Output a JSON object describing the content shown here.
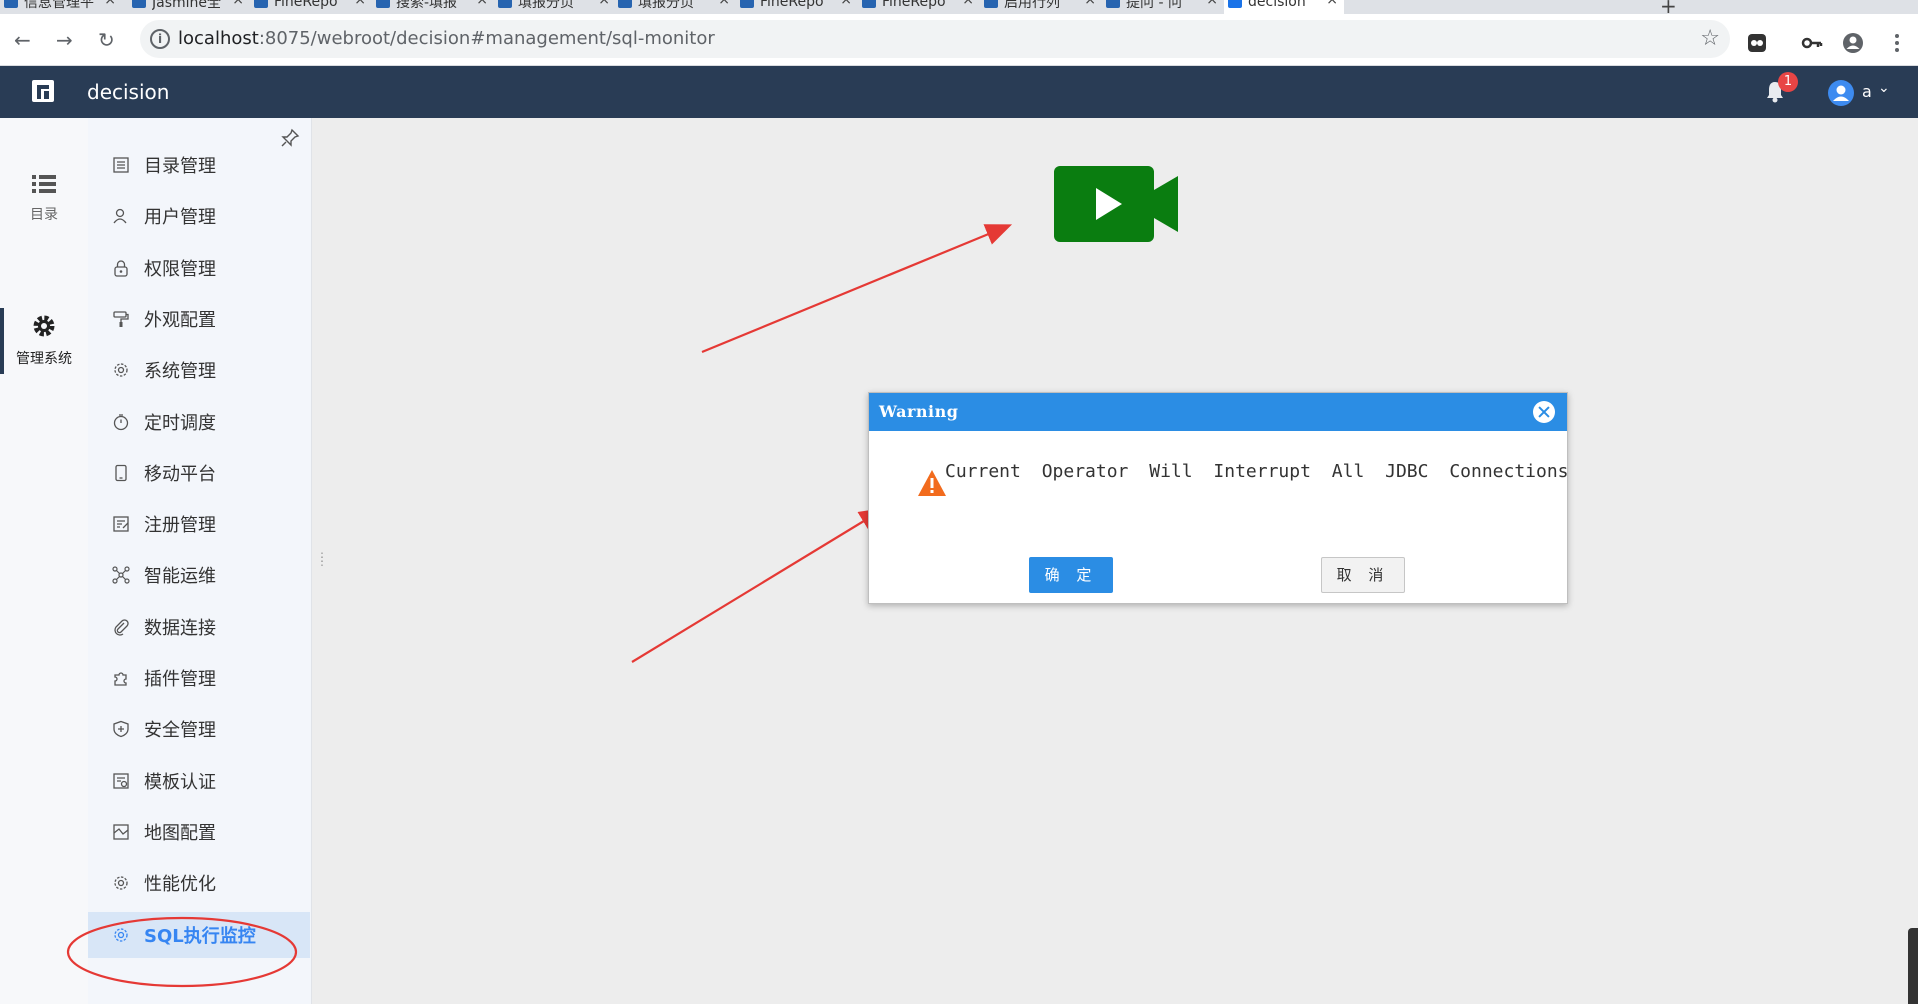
{
  "browser": {
    "tabs": [
      {
        "label": "信息管理平",
        "active": false
      },
      {
        "label": "Jasmine全",
        "active": false
      },
      {
        "label": "FineRepo",
        "active": false
      },
      {
        "label": "搜索-填报",
        "active": false
      },
      {
        "label": "填报分页",
        "active": false
      },
      {
        "label": "填报分页",
        "active": false
      },
      {
        "label": "FineRepo",
        "active": false
      },
      {
        "label": "FineRepo",
        "active": false
      },
      {
        "label": "启用行列",
        "active": false
      },
      {
        "label": "提问 - 问",
        "active": false
      },
      {
        "label": "decision",
        "active": true
      }
    ],
    "tab_close_glyph": "×",
    "new_tab_glyph": "+",
    "url_host": "localhost",
    "url_path": ":8075/webroot/decision#management/sql-monitor"
  },
  "app": {
    "title": "decision",
    "notification_count": "1",
    "username": "a"
  },
  "rail": {
    "items": [
      {
        "label": "目录",
        "icon": "list-icon",
        "active": false
      },
      {
        "label": "管理系统",
        "icon": "gear-icon",
        "active": true
      }
    ]
  },
  "menu": {
    "items": [
      {
        "label": "目录管理",
        "icon": "directory-icon"
      },
      {
        "label": "用户管理",
        "icon": "user-icon"
      },
      {
        "label": "权限管理",
        "icon": "lock-icon"
      },
      {
        "label": "外观配置",
        "icon": "paint-roller-icon"
      },
      {
        "label": "系统管理",
        "icon": "settings-icon"
      },
      {
        "label": "定时调度",
        "icon": "timer-icon"
      },
      {
        "label": "移动平台",
        "icon": "mobile-icon"
      },
      {
        "label": "注册管理",
        "icon": "register-icon"
      },
      {
        "label": "智能运维",
        "icon": "network-icon"
      },
      {
        "label": "数据连接",
        "icon": "paperclip-icon"
      },
      {
        "label": "插件管理",
        "icon": "puzzle-icon"
      },
      {
        "label": "安全管理",
        "icon": "shield-icon"
      },
      {
        "label": "模板认证",
        "icon": "template-icon"
      },
      {
        "label": "地图配置",
        "icon": "map-icon"
      },
      {
        "label": "性能优化",
        "icon": "performance-icon"
      },
      {
        "label": "SQL执行监控",
        "icon": "sql-monitor-icon",
        "active": true
      }
    ]
  },
  "dialog": {
    "title": "Warning",
    "message": "Current Operator Will Interrupt All JDBC Connections",
    "ok_label": "确 定",
    "cancel_label": "取 消"
  },
  "colors": {
    "app_header": "#293c55",
    "accent_blue": "#2b8de4",
    "video_green": "#0a7d10",
    "annotation_red": "#e53935"
  }
}
